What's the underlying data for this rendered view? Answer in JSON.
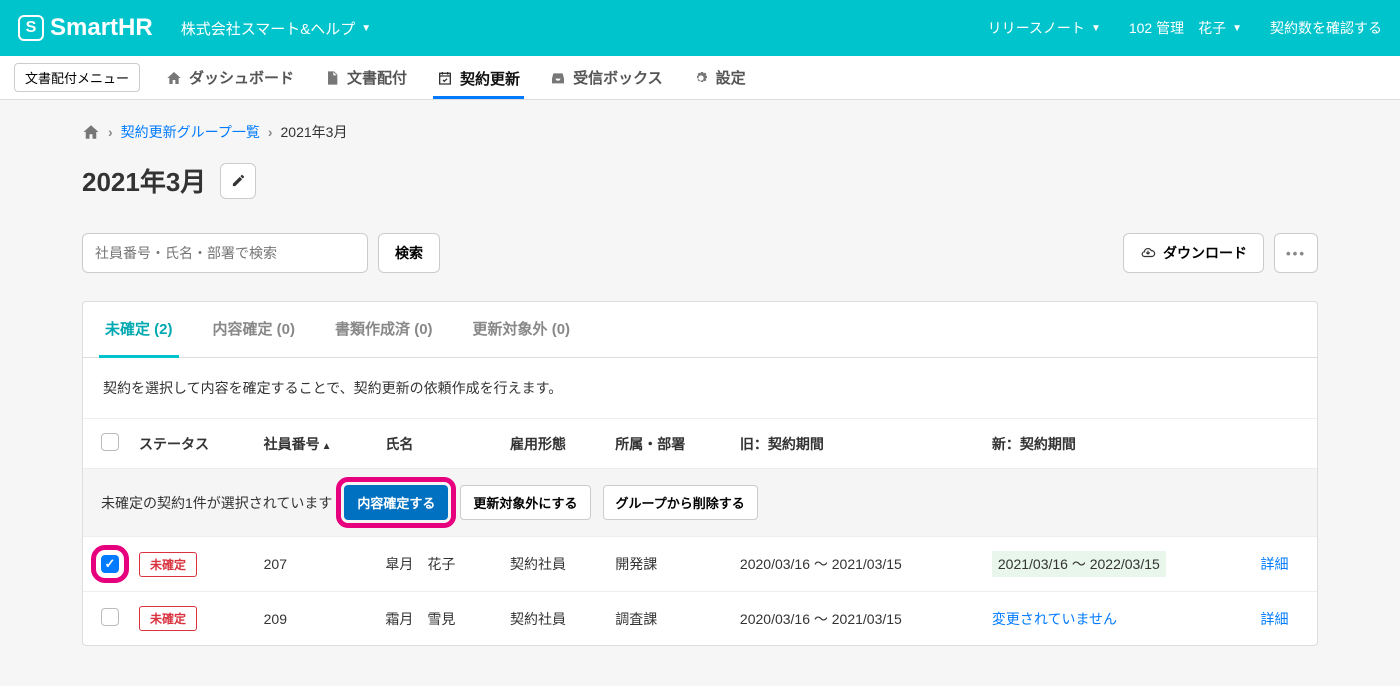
{
  "header": {
    "logo_text": "SmartHR",
    "logo_letter": "S",
    "company": "株式会社スマート&ヘルプ",
    "release_notes": "リリースノート",
    "user": "102 管理　花子",
    "contract_check": "契約数を確認する"
  },
  "menu": {
    "dropdown": "文書配付メニュー",
    "items": [
      {
        "label": "ダッシュボード"
      },
      {
        "label": "文書配付"
      },
      {
        "label": "契約更新"
      },
      {
        "label": "受信ボックス"
      },
      {
        "label": "設定"
      }
    ]
  },
  "breadcrumb": {
    "link": "契約更新グループ一覧",
    "current": "2021年3月"
  },
  "page_title": "2021年3月",
  "search": {
    "placeholder": "社員番号・氏名・部署で検索",
    "button": "検索"
  },
  "download": "ダウンロード",
  "tabs": [
    {
      "label": "未確定 (2)"
    },
    {
      "label": "内容確定 (0)"
    },
    {
      "label": "書類作成済 (0)"
    },
    {
      "label": "更新対象外 (0)"
    }
  ],
  "helper": "契約を選択して内容を確定することで、契約更新の依頼作成を行えます。",
  "columns": {
    "status": "ステータス",
    "emp_no": "社員番号",
    "name": "氏名",
    "emp_type": "雇用形態",
    "dept": "所属・部署",
    "old_term": "旧：契約期間",
    "new_term": "新：契約期間"
  },
  "action_bar": {
    "text": "未確定の契約1件が選択されています",
    "confirm": "内容確定する",
    "exclude": "更新対象外にする",
    "remove": "グループから削除する"
  },
  "status_label": "未確定",
  "detail_label": "詳細",
  "unchanged_label": "変更されていません",
  "rows": [
    {
      "checked": true,
      "emp_no": "207",
      "name": "皐月　花子",
      "emp_type": "契約社員",
      "dept": "開発課",
      "old_term": "2020/03/16 〜 2021/03/15",
      "new_term": "2021/03/16 〜 2022/03/15",
      "changed": true
    },
    {
      "checked": false,
      "emp_no": "209",
      "name": "霜月　雪見",
      "emp_type": "契約社員",
      "dept": "調査課",
      "old_term": "2020/03/16 〜 2021/03/15",
      "new_term": "",
      "changed": false
    }
  ]
}
